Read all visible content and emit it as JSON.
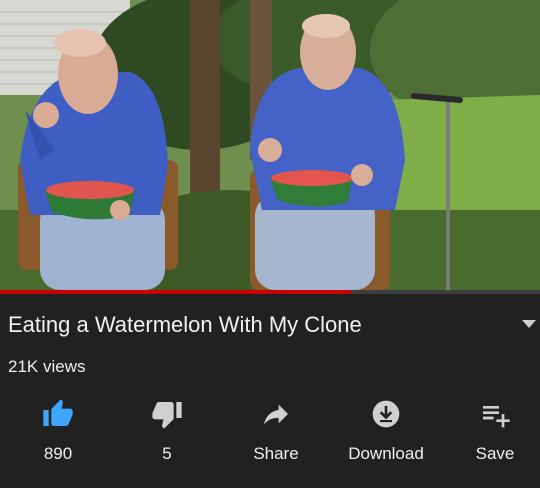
{
  "video": {
    "title": "Eating a Watermelon With My Clone",
    "views": "21K views",
    "progress": 0.65
  },
  "actions": {
    "like": {
      "icon": "thumbs-up-icon",
      "label": "890",
      "active": true
    },
    "dislike": {
      "icon": "thumbs-down-icon",
      "label": "5"
    },
    "share": {
      "icon": "share-arrow-icon",
      "label": "Share"
    },
    "download": {
      "icon": "download-icon",
      "label": "Download"
    },
    "save": {
      "icon": "playlist-add-icon",
      "label": "Save"
    }
  },
  "colors": {
    "background": "#212121",
    "accent_blue": "#3ea6ff",
    "progress_red": "#cc0000",
    "icon_gray": "#d0d0d0"
  }
}
